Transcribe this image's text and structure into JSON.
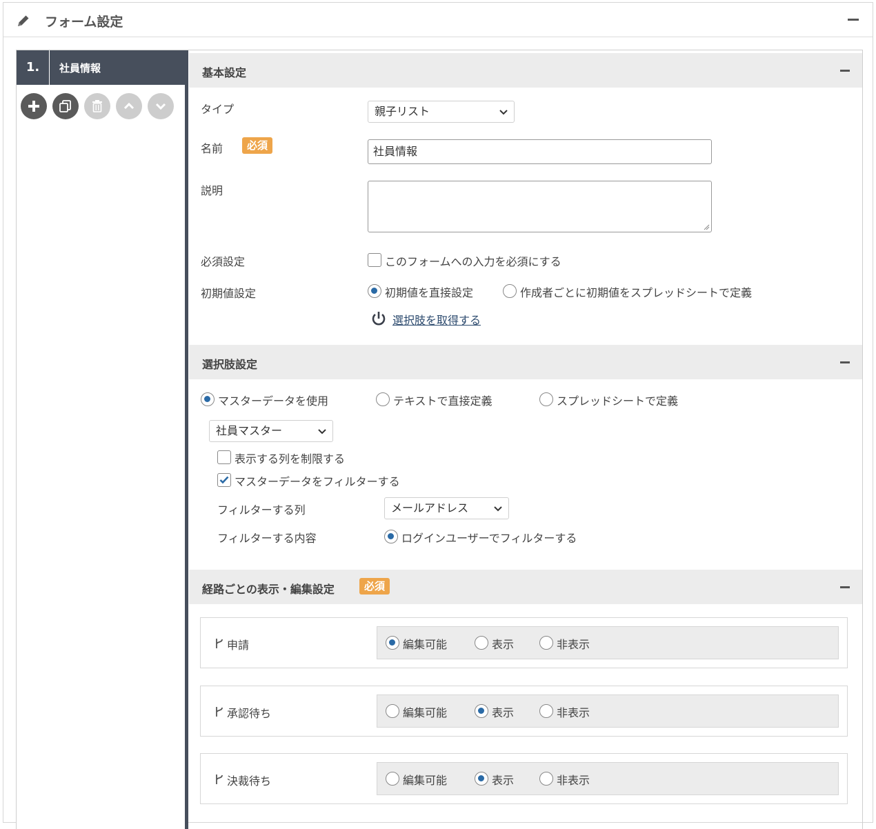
{
  "header": {
    "title": "フォーム設定",
    "icon": "pencil-icon"
  },
  "sidebar": {
    "items": [
      {
        "num": "1.",
        "label": "社員情報"
      }
    ],
    "buttons": [
      "add-icon",
      "copy-icon",
      "trash-icon",
      "chevron-up-icon",
      "chevron-down-icon"
    ]
  },
  "basic": {
    "title": "基本設定",
    "type_label": "タイプ",
    "type_value": "親子リスト",
    "name_label": "名前",
    "required_badge": "必須",
    "name_value": "社員情報",
    "desc_label": "説明",
    "desc_value": "",
    "required_setting_label": "必須設定",
    "required_checkbox": "このフォームへの入力を必須にする",
    "default_label": "初期値設定",
    "default_opt1": "初期値を直接設定",
    "default_opt2": "作成者ごとに初期値をスプレッドシートで定義",
    "fetch_link": "選択肢を取得する"
  },
  "choices": {
    "title": "選択肢設定",
    "opt_master": "マスターデータを使用",
    "opt_text": "テキストで直接定義",
    "opt_sheet": "スプレッドシートで定義",
    "master_select": "社員マスター",
    "limit_columns": "表示する列を制限する",
    "filter_master": "マスターデータをフィルターする",
    "filter_column_label": "フィルターする列",
    "filter_column_value": "メールアドレス",
    "filter_content_label": "フィルターする内容",
    "filter_content_opt": "ログインユーザーでフィルターする"
  },
  "routes": {
    "title": "経路ごとの表示・編集設定",
    "required_badge": "必須",
    "opt_edit": "編集可能",
    "opt_show": "表示",
    "opt_hide": "非表示",
    "items": [
      {
        "name": "申請",
        "selected": "編集可能"
      },
      {
        "name": "承認待ち",
        "selected": "表示"
      },
      {
        "name": "決裁待ち",
        "selected": "表示"
      }
    ]
  },
  "colors": {
    "sidebar": "#474f5c",
    "badge": "#eea54a",
    "radio_dot": "#2a6aa6",
    "section_bg": "#ececec"
  }
}
